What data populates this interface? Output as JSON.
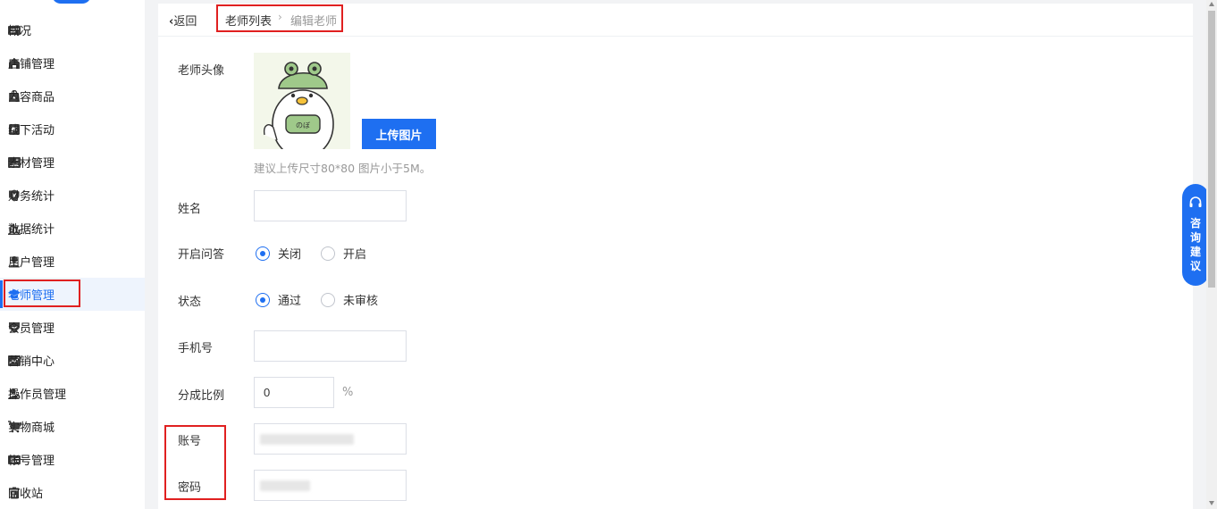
{
  "sidebar": {
    "items": [
      {
        "label": "概况",
        "icon": "overview-icon"
      },
      {
        "label": "店铺管理",
        "icon": "shop-icon"
      },
      {
        "label": "内容商品",
        "icon": "bag-icon"
      },
      {
        "label": "线下活动",
        "icon": "flag-icon"
      },
      {
        "label": "素材管理",
        "icon": "image-icon"
      },
      {
        "label": "财务统计",
        "icon": "finance-shield-icon"
      },
      {
        "label": "数据统计",
        "icon": "bar-chart-icon"
      },
      {
        "label": "用户管理",
        "icon": "user-icon"
      },
      {
        "label": "老师管理",
        "icon": "graduation-cap-icon",
        "active": true
      },
      {
        "label": "会员管理",
        "icon": "member-badge-icon"
      },
      {
        "label": "营销中心",
        "icon": "trend-chart-icon"
      },
      {
        "label": "操作员管理",
        "icon": "operator-icon"
      },
      {
        "label": "实物商城",
        "icon": "cart-icon"
      },
      {
        "label": "帐号管理",
        "icon": "id-card-icon"
      },
      {
        "label": "回收站",
        "icon": "trash-icon"
      }
    ]
  },
  "header": {
    "back_label": "返回",
    "breadcrumb": [
      "老师列表",
      "编辑老师"
    ]
  },
  "form": {
    "avatar_label": "老师头像",
    "upload_button": "上传图片",
    "upload_hint": "建议上传尺寸80*80 图片小于5M。",
    "name_label": "姓名",
    "name_value": "",
    "qa_label": "开启问答",
    "qa_options": [
      "关闭",
      "开启"
    ],
    "qa_selected": "关闭",
    "status_label": "状态",
    "status_options": [
      "通过",
      "未审核"
    ],
    "status_selected": "通过",
    "phone_label": "手机号",
    "phone_value": "",
    "share_label": "分成比例",
    "share_value": "0",
    "share_unit": "%",
    "account_label": "账号",
    "password_label": "密码"
  },
  "consult_button": "咨询建议",
  "colors": {
    "accent": "#1e6ff1",
    "highlight_box": "#e02020"
  }
}
